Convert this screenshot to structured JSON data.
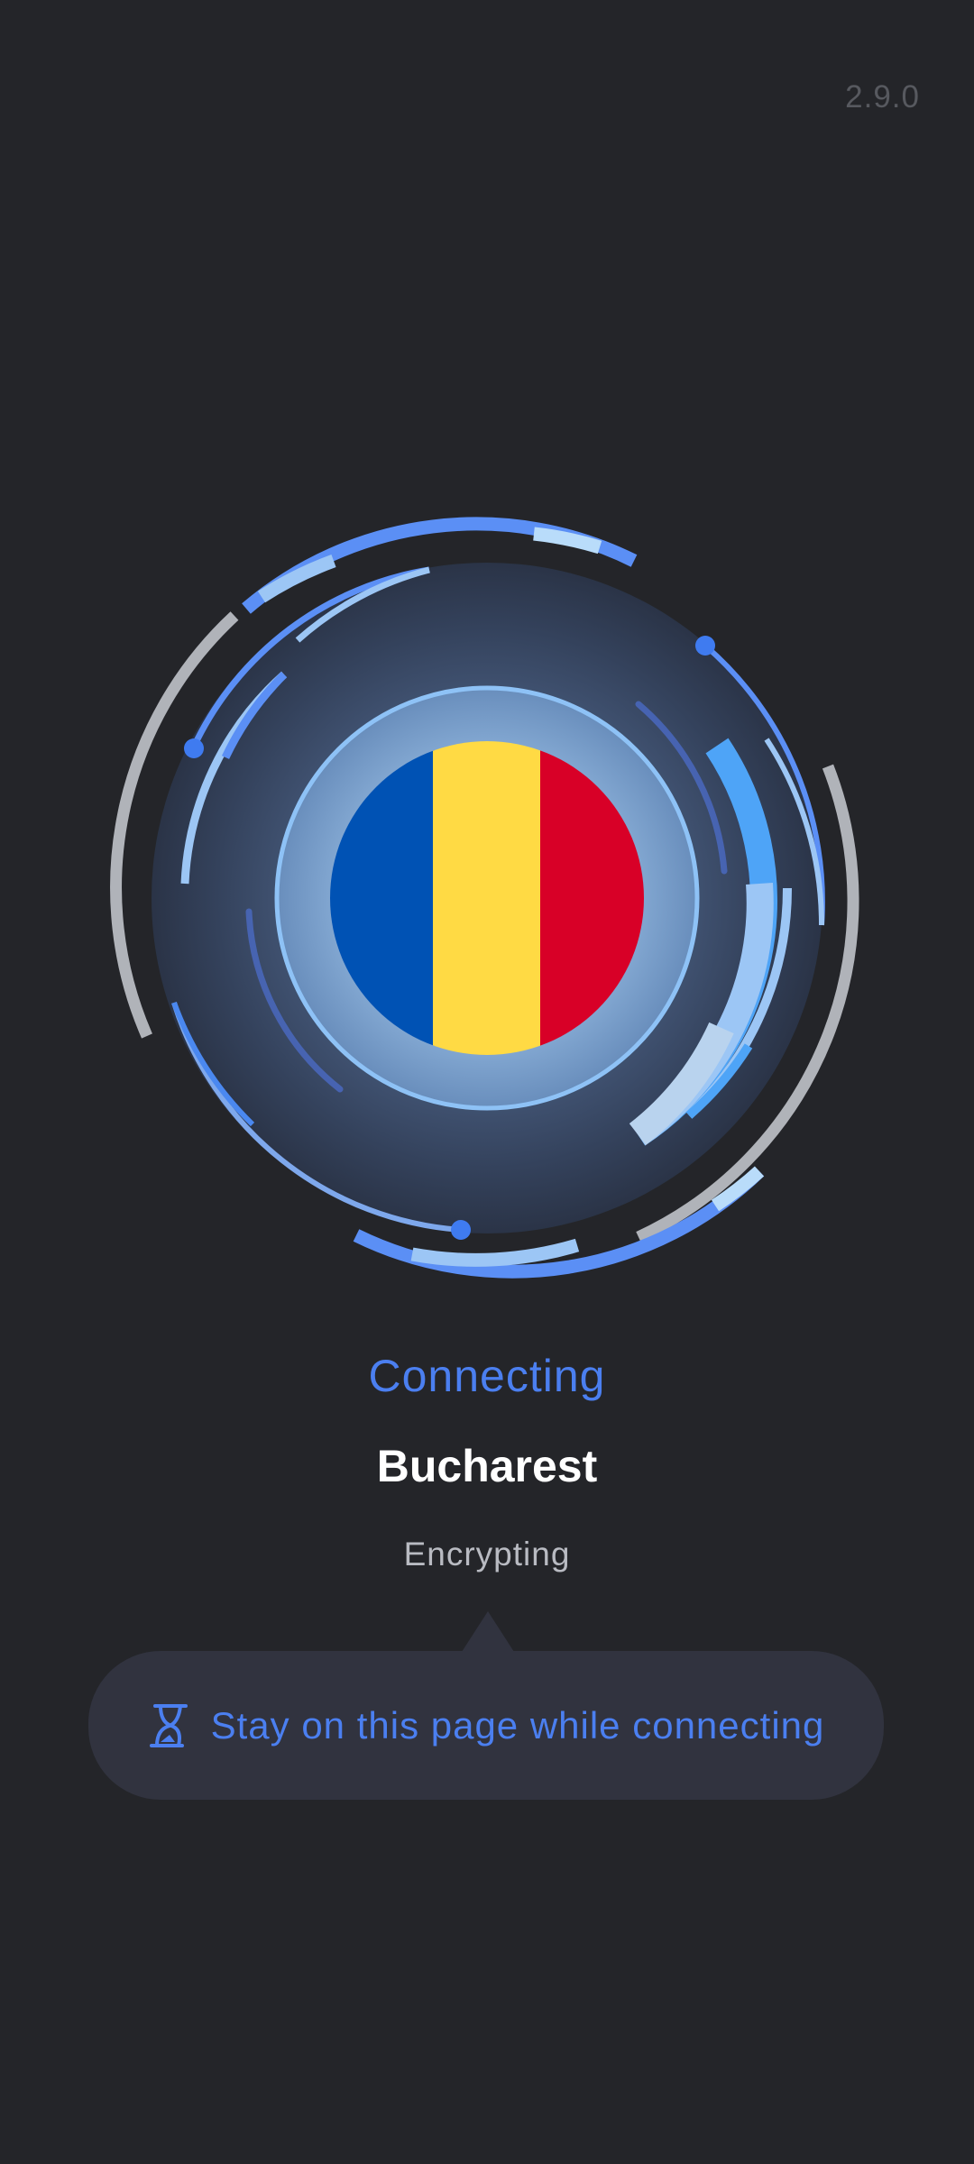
{
  "app": {
    "version": "2.9.0"
  },
  "connection": {
    "status": "Connecting",
    "location": "Bucharest",
    "substatus": "Encrypting",
    "country_flag": {
      "icon": "romania-flag-icon",
      "colors": [
        "#0052b4",
        "#ffda44",
        "#d80027"
      ]
    }
  },
  "tooltip": {
    "icon": "hourglass-icon",
    "text": "Stay on this page while connecting"
  },
  "colors": {
    "background": "#242529",
    "accent": "#4b7ff0",
    "ring_light": "#9cc6f5",
    "ring_gray": "#b0b3b9"
  }
}
